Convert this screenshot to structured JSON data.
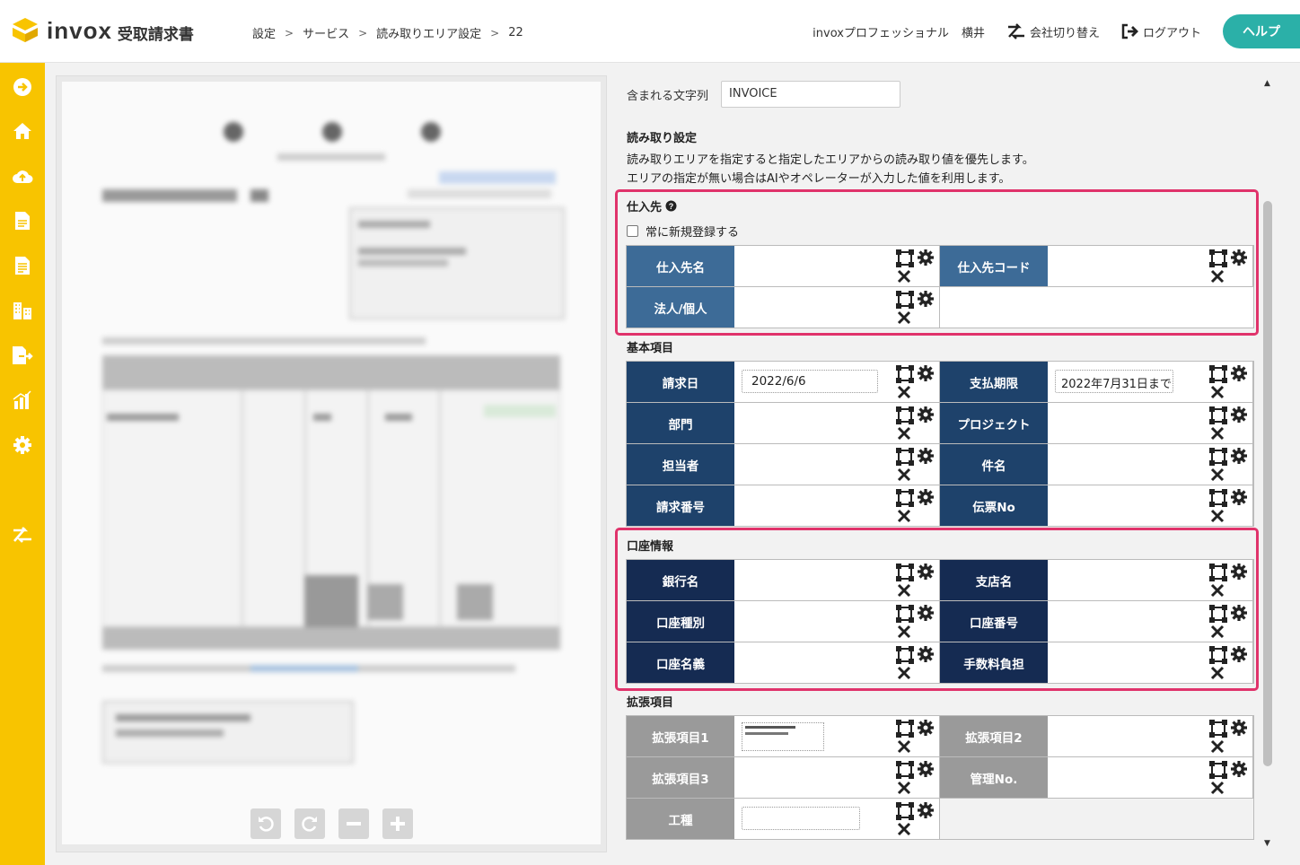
{
  "app": {
    "logo_text": "invox",
    "logo_sub": "受取請求書",
    "brand_color": "#f8c400",
    "accent_color": "#2bb0a8"
  },
  "breadcrumb": [
    "設定",
    "サービス",
    "読み取りエリア設定",
    "22"
  ],
  "header": {
    "org_name": "invoxプロフェッショナル",
    "user_name": "横井",
    "switch_company": "会社切り替え",
    "logout": "ログアウト",
    "help": "ヘルプ"
  },
  "sidebar_icons": [
    "arrow-right-circle-icon",
    "home-icon",
    "cloud-upload-icon",
    "document-icon",
    "document-list-icon",
    "buildings-icon",
    "export-icon",
    "chart-icon",
    "gear-icon",
    "switch-icon"
  ],
  "viewer": {
    "controls": [
      "rotate-left-icon",
      "rotate-right-icon",
      "zoom-out-icon",
      "zoom-in-icon"
    ]
  },
  "panel": {
    "contains_label": "含まれる文字列",
    "contains_value": "INVOICE",
    "read_settings_title": "読み取り設定",
    "read_settings_desc1": "読み取りエリアを指定すると指定したエリアからの読み取り値を優先します。",
    "read_settings_desc2": "エリアの指定が無い場合はAIやオペレーターが入力した値を利用します。",
    "supplier": {
      "title": "仕入先",
      "always_register": "常に新規登録する",
      "fields": {
        "name": "仕入先名",
        "code": "仕入先コード",
        "corp": "法人/個人"
      }
    },
    "basic": {
      "title": "基本項目",
      "fields": {
        "invoice_date": "請求日",
        "invoice_date_value": "2022/6/6",
        "due_date": "支払期限",
        "due_date_value": "2022年7月31日まで",
        "department": "部門",
        "project": "プロジェクト",
        "person": "担当者",
        "subject": "件名",
        "invoice_no": "請求番号",
        "slip_no": "伝票No"
      }
    },
    "account": {
      "title": "口座情報",
      "fields": {
        "bank": "銀行名",
        "branch": "支店名",
        "type": "口座種別",
        "number": "口座番号",
        "holder": "口座名義",
        "fee": "手数料負担"
      }
    },
    "extension": {
      "title": "拡張項目",
      "fields": {
        "ext1": "拡張項目1",
        "ext2": "拡張項目2",
        "ext3": "拡張項目3",
        "mgmt": "管理No.",
        "kind": "工種"
      }
    }
  }
}
